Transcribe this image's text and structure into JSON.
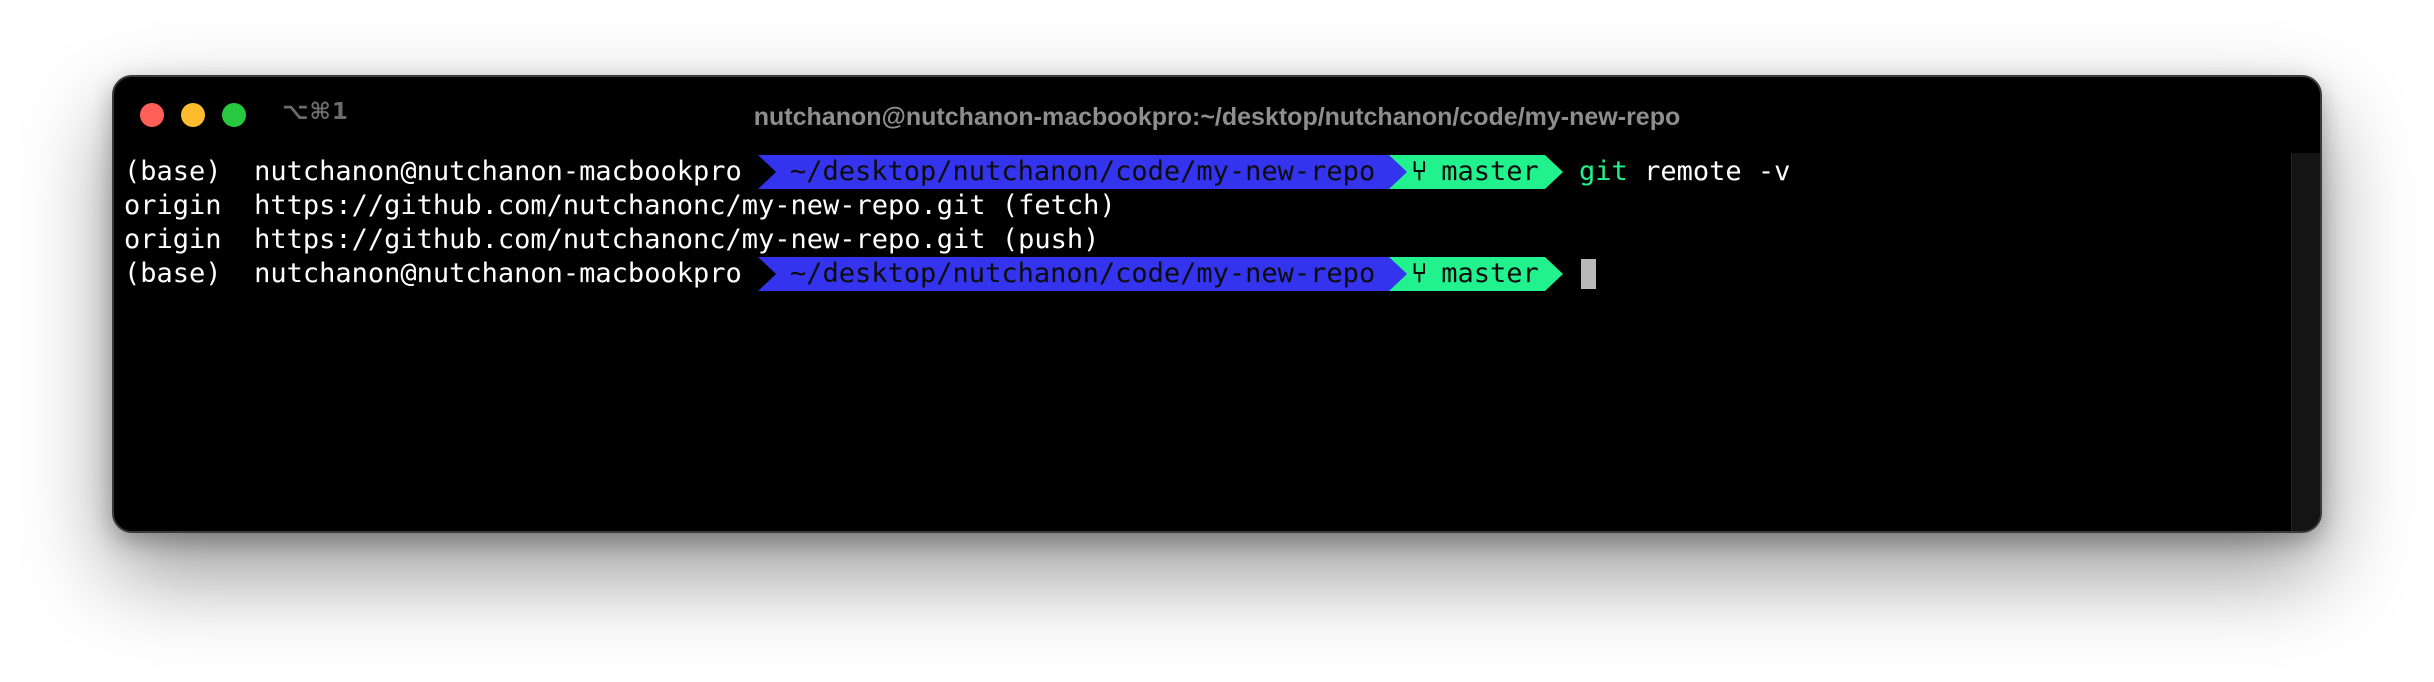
{
  "window": {
    "shortcut": "⌥⌘1",
    "title": "nutchanon@nutchanon-macbookpro:~/desktop/nutchanon/code/my-new-repo"
  },
  "colors": {
    "path_segment": "#3434ee",
    "branch_segment": "#21f28e",
    "git_command": "#21f28e",
    "background": "#000000"
  },
  "terminal": {
    "prompt1": {
      "env": "(base)",
      "user_host": "nutchanon@nutchanon-macbookpro",
      "path": "~/desktop/nutchanon/code/my-new-repo",
      "branch_icon": "git-branch-icon",
      "branch": "master",
      "command_name": "git",
      "command_args": "remote -v"
    },
    "output": [
      {
        "remote": "origin",
        "url": "https://github.com/nutchanonc/my-new-repo.git",
        "type": "(fetch)"
      },
      {
        "remote": "origin",
        "url": "https://github.com/nutchanonc/my-new-repo.git",
        "type": "(push)"
      }
    ],
    "prompt2": {
      "env": "(base)",
      "user_host": "nutchanon@nutchanon-macbookpro",
      "path": "~/desktop/nutchanon/code/my-new-repo",
      "branch": "master"
    }
  }
}
